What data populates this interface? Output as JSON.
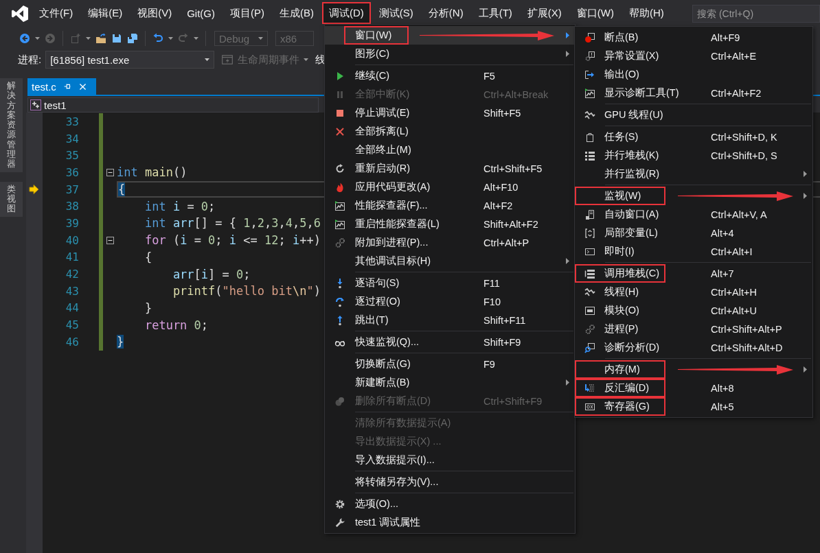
{
  "menubar": {
    "items": [
      {
        "label": "文件(F)",
        "selected": false,
        "highlighted": false
      },
      {
        "label": "编辑(E)",
        "selected": false,
        "highlighted": false
      },
      {
        "label": "视图(V)",
        "selected": false,
        "highlighted": false
      },
      {
        "label": "Git(G)",
        "selected": false,
        "highlighted": false
      },
      {
        "label": "项目(P)",
        "selected": false,
        "highlighted": false
      },
      {
        "label": "生成(B)",
        "selected": false,
        "highlighted": false
      },
      {
        "label": "调试(D)",
        "selected": true,
        "highlighted": true
      },
      {
        "label": "测试(S)",
        "selected": false,
        "highlighted": false
      },
      {
        "label": "分析(N)",
        "selected": false,
        "highlighted": false
      },
      {
        "label": "工具(T)",
        "selected": false,
        "highlighted": false
      },
      {
        "label": "扩展(X)",
        "selected": false,
        "highlighted": false
      },
      {
        "label": "窗口(W)",
        "selected": false,
        "highlighted": false
      },
      {
        "label": "帮助(H)",
        "selected": false,
        "highlighted": false
      }
    ],
    "search": {
      "placeholder": "搜索 (Ctrl+Q)"
    }
  },
  "toolbar": {
    "configuration": "Debug",
    "platform": "x86"
  },
  "debug_location": {
    "label": "进程:",
    "process": "[61856] test1.exe",
    "lifecycle_events": "生命周期事件",
    "thread_label": "线"
  },
  "side_tabs": [
    {
      "label": "解决方案资源管理器"
    },
    {
      "label": "类视图"
    }
  ],
  "editor": {
    "tab": {
      "label": "test.c",
      "selected": true
    },
    "scope": "test1",
    "lines": [
      {
        "number": "33",
        "current": false,
        "foldable": false,
        "modified": true
      },
      {
        "number": "34",
        "current": false,
        "foldable": false,
        "modified": true
      },
      {
        "number": "35",
        "current": false,
        "foldable": false,
        "modified": true
      },
      {
        "number": "36",
        "current": false,
        "foldable": true,
        "modified": true,
        "tokens": [
          {
            "kind": "keyword",
            "text": "int"
          },
          {
            "kind": "function",
            "text": " main"
          },
          {
            "kind": "plain",
            "text": "()"
          }
        ]
      },
      {
        "number": "37",
        "current": true,
        "foldable": false,
        "modified": true,
        "tokens": [
          {
            "kind": "brace-match",
            "text": "{"
          }
        ]
      },
      {
        "number": "38",
        "current": false,
        "foldable": false,
        "modified": true,
        "tokens": [
          {
            "kind": "keyword",
            "text": "    int"
          },
          {
            "kind": "variable",
            "text": " i"
          },
          {
            "kind": "plain",
            "text": " = "
          },
          {
            "kind": "number",
            "text": "0"
          },
          {
            "kind": "plain",
            "text": ";"
          }
        ]
      },
      {
        "number": "39",
        "current": false,
        "foldable": false,
        "modified": true,
        "tokens": [
          {
            "kind": "keyword",
            "text": "    int"
          },
          {
            "kind": "variable",
            "text": " arr"
          },
          {
            "kind": "plain",
            "text": "[] = { "
          },
          {
            "kind": "number",
            "text": "1"
          },
          {
            "kind": "plain",
            "text": ","
          },
          {
            "kind": "number",
            "text": "2"
          },
          {
            "kind": "plain",
            "text": ","
          },
          {
            "kind": "number",
            "text": "3"
          },
          {
            "kind": "plain",
            "text": ","
          },
          {
            "kind": "number",
            "text": "4"
          },
          {
            "kind": "plain",
            "text": ","
          },
          {
            "kind": "number",
            "text": "5"
          },
          {
            "kind": "plain",
            "text": ","
          },
          {
            "kind": "number",
            "text": "6"
          }
        ]
      },
      {
        "number": "40",
        "current": false,
        "foldable": true,
        "modified": true,
        "tokens": [
          {
            "kind": "control",
            "text": "    for"
          },
          {
            "kind": "plain",
            "text": " ("
          },
          {
            "kind": "variable",
            "text": "i"
          },
          {
            "kind": "plain",
            "text": " = "
          },
          {
            "kind": "number",
            "text": "0"
          },
          {
            "kind": "plain",
            "text": "; "
          },
          {
            "kind": "variable",
            "text": "i"
          },
          {
            "kind": "plain",
            "text": " <= "
          },
          {
            "kind": "number",
            "text": "12"
          },
          {
            "kind": "plain",
            "text": "; "
          },
          {
            "kind": "variable",
            "text": "i"
          },
          {
            "kind": "plain",
            "text": "++)"
          }
        ]
      },
      {
        "number": "41",
        "current": false,
        "foldable": false,
        "modified": true,
        "tokens": [
          {
            "kind": "plain",
            "text": "    {"
          }
        ]
      },
      {
        "number": "42",
        "current": false,
        "foldable": false,
        "modified": true,
        "tokens": [
          {
            "kind": "variable",
            "text": "        arr"
          },
          {
            "kind": "plain",
            "text": "["
          },
          {
            "kind": "variable",
            "text": "i"
          },
          {
            "kind": "plain",
            "text": "] = "
          },
          {
            "kind": "number",
            "text": "0"
          },
          {
            "kind": "plain",
            "text": ";"
          }
        ]
      },
      {
        "number": "43",
        "current": false,
        "foldable": false,
        "modified": true,
        "tokens": [
          {
            "kind": "function",
            "text": "        printf"
          },
          {
            "kind": "plain",
            "text": "("
          },
          {
            "kind": "string",
            "text": "\"hello bit"
          },
          {
            "kind": "escape",
            "text": "\\n"
          },
          {
            "kind": "string",
            "text": "\""
          },
          {
            "kind": "plain",
            "text": ")"
          }
        ]
      },
      {
        "number": "44",
        "current": false,
        "foldable": false,
        "modified": true,
        "tokens": [
          {
            "kind": "plain",
            "text": "    }"
          }
        ]
      },
      {
        "number": "45",
        "current": false,
        "foldable": false,
        "modified": true,
        "tokens": [
          {
            "kind": "control",
            "text": "    return"
          },
          {
            "kind": "number",
            "text": " 0"
          },
          {
            "kind": "plain",
            "text": ";"
          }
        ]
      },
      {
        "number": "46",
        "current": false,
        "foldable": false,
        "modified": true,
        "tokens": [
          {
            "kind": "brace-match",
            "text": "}"
          }
        ]
      }
    ]
  },
  "debug_menu": {
    "groups": [
      [
        {
          "label": "窗口(W)",
          "submenu": true,
          "disabled": false,
          "selected": true,
          "highlighted": true,
          "arrow": true
        },
        {
          "label": "图形(C)",
          "submenu": true,
          "disabled": false,
          "selected": false,
          "highlighted": false,
          "arrow": false
        }
      ],
      [
        {
          "label": "继续(C)",
          "shortcut": "F5",
          "submenu": false,
          "disabled": false,
          "selected": false,
          "highlighted": false,
          "arrow": false
        },
        {
          "label": "全部中断(K)",
          "shortcut": "Ctrl+Alt+Break",
          "submenu": false,
          "disabled": true,
          "selected": false,
          "highlighted": false,
          "arrow": false
        },
        {
          "label": "停止调试(E)",
          "shortcut": "Shift+F5",
          "submenu": false,
          "disabled": false,
          "selected": false,
          "highlighted": false,
          "arrow": false
        },
        {
          "label": "全部拆离(L)",
          "submenu": false,
          "disabled": false,
          "selected": false,
          "highlighted": false,
          "arrow": false
        },
        {
          "label": "全部终止(M)",
          "submenu": false,
          "disabled": false,
          "selected": false,
          "highlighted": false,
          "arrow": false
        },
        {
          "label": "重新启动(R)",
          "shortcut": "Ctrl+Shift+F5",
          "submenu": false,
          "disabled": false,
          "selected": false,
          "highlighted": false,
          "arrow": false
        },
        {
          "label": "应用代码更改(A)",
          "shortcut": "Alt+F10",
          "submenu": false,
          "disabled": false,
          "selected": false,
          "highlighted": false,
          "arrow": false
        },
        {
          "label": "性能探查器(F)...",
          "shortcut": "Alt+F2",
          "submenu": false,
          "disabled": false,
          "selected": false,
          "highlighted": false,
          "arrow": false
        },
        {
          "label": "重启性能探查器(L)",
          "shortcut": "Shift+Alt+F2",
          "submenu": false,
          "disabled": false,
          "selected": false,
          "highlighted": false,
          "arrow": false
        },
        {
          "label": "附加到进程(P)...",
          "shortcut": "Ctrl+Alt+P",
          "submenu": false,
          "disabled": false,
          "selected": false,
          "highlighted": false,
          "arrow": false
        },
        {
          "label": "其他调试目标(H)",
          "submenu": true,
          "disabled": false,
          "selected": false,
          "highlighted": false,
          "arrow": false
        }
      ],
      [
        {
          "label": "逐语句(S)",
          "shortcut": "F11",
          "submenu": false,
          "disabled": false,
          "selected": false,
          "highlighted": false,
          "arrow": false
        },
        {
          "label": "逐过程(O)",
          "shortcut": "F10",
          "submenu": false,
          "disabled": false,
          "selected": false,
          "highlighted": false,
          "arrow": false
        },
        {
          "label": "跳出(T)",
          "shortcut": "Shift+F11",
          "submenu": false,
          "disabled": false,
          "selected": false,
          "highlighted": false,
          "arrow": false
        }
      ],
      [
        {
          "label": "快速监视(Q)...",
          "shortcut": "Shift+F9",
          "submenu": false,
          "disabled": false,
          "selected": false,
          "highlighted": false,
          "arrow": false
        }
      ],
      [
        {
          "label": "切换断点(G)",
          "shortcut": "F9",
          "submenu": false,
          "disabled": false,
          "selected": false,
          "highlighted": false,
          "arrow": false
        },
        {
          "label": "新建断点(B)",
          "submenu": true,
          "disabled": false,
          "selected": false,
          "highlighted": false,
          "arrow": false
        },
        {
          "label": "删除所有断点(D)",
          "shortcut": "Ctrl+Shift+F9",
          "submenu": false,
          "disabled": true,
          "selected": false,
          "highlighted": false,
          "arrow": false
        }
      ],
      [
        {
          "label": "清除所有数据提示(A)",
          "submenu": false,
          "disabled": true,
          "selected": false,
          "highlighted": false,
          "arrow": false
        },
        {
          "label": "导出数据提示(X) ...",
          "submenu": false,
          "disabled": true,
          "selected": false,
          "highlighted": false,
          "arrow": false
        },
        {
          "label": "导入数据提示(I)...",
          "submenu": false,
          "disabled": false,
          "selected": false,
          "highlighted": false,
          "arrow": false
        }
      ],
      [
        {
          "label": "将转储另存为(V)...",
          "submenu": false,
          "disabled": false,
          "selected": false,
          "highlighted": false,
          "arrow": false
        }
      ],
      [
        {
          "label": "选项(O)...",
          "submenu": false,
          "disabled": false,
          "selected": false,
          "highlighted": false,
          "arrow": false
        },
        {
          "label": "test1 调试属性",
          "submenu": false,
          "disabled": false,
          "selected": false,
          "highlighted": false,
          "arrow": false
        }
      ]
    ]
  },
  "window_submenu": {
    "groups": [
      [
        {
          "label": "断点(B)",
          "shortcut": "Alt+F9",
          "submenu": false,
          "disabled": false,
          "selected": false,
          "highlighted": false,
          "arrow": false
        },
        {
          "label": "异常设置(X)",
          "shortcut": "Ctrl+Alt+E",
          "submenu": false,
          "disabled": false,
          "selected": false,
          "highlighted": false,
          "arrow": false
        },
        {
          "label": "输出(O)",
          "submenu": false,
          "disabled": false,
          "selected": false,
          "highlighted": false,
          "arrow": false
        },
        {
          "label": "显示诊断工具(T)",
          "shortcut": "Ctrl+Alt+F2",
          "submenu": false,
          "disabled": false,
          "selected": false,
          "highlighted": false,
          "arrow": false
        }
      ],
      [
        {
          "label": "GPU 线程(U)",
          "submenu": false,
          "disabled": false,
          "selected": false,
          "highlighted": false,
          "arrow": false
        }
      ],
      [
        {
          "label": "任务(S)",
          "shortcut": "Ctrl+Shift+D, K",
          "submenu": false,
          "disabled": false,
          "selected": false,
          "highlighted": false,
          "arrow": false
        },
        {
          "label": "并行堆栈(K)",
          "shortcut": "Ctrl+Shift+D, S",
          "submenu": false,
          "disabled": false,
          "selected": false,
          "highlighted": false,
          "arrow": false
        },
        {
          "label": "并行监视(R)",
          "submenu": true,
          "disabled": false,
          "selected": false,
          "highlighted": false,
          "arrow": false
        }
      ],
      [
        {
          "label": "监视(W)",
          "submenu": true,
          "disabled": false,
          "selected": false,
          "highlighted": true,
          "arrow": true
        },
        {
          "label": "自动窗口(A)",
          "shortcut": "Ctrl+Alt+V, A",
          "submenu": false,
          "disabled": false,
          "selected": false,
          "highlighted": false,
          "arrow": false
        },
        {
          "label": "局部变量(L)",
          "shortcut": "Alt+4",
          "submenu": false,
          "disabled": false,
          "selected": false,
          "highlighted": false,
          "arrow": false
        },
        {
          "label": "即时(I)",
          "shortcut": "Ctrl+Alt+I",
          "submenu": false,
          "disabled": false,
          "selected": false,
          "highlighted": false,
          "arrow": false
        }
      ],
      [
        {
          "label": "调用堆栈(C)",
          "shortcut": "Alt+7",
          "submenu": false,
          "disabled": false,
          "selected": false,
          "highlighted": true,
          "arrow": false
        },
        {
          "label": "线程(H)",
          "shortcut": "Ctrl+Alt+H",
          "submenu": false,
          "disabled": false,
          "selected": false,
          "highlighted": false,
          "arrow": false
        },
        {
          "label": "模块(O)",
          "shortcut": "Ctrl+Alt+U",
          "submenu": false,
          "disabled": false,
          "selected": false,
          "highlighted": false,
          "arrow": false
        },
        {
          "label": "进程(P)",
          "shortcut": "Ctrl+Shift+Alt+P",
          "submenu": false,
          "disabled": false,
          "selected": false,
          "highlighted": false,
          "arrow": false
        },
        {
          "label": "诊断分析(D)",
          "shortcut": "Ctrl+Shift+Alt+D",
          "submenu": false,
          "disabled": false,
          "selected": false,
          "highlighted": false,
          "arrow": false
        }
      ],
      [
        {
          "label": "内存(M)",
          "submenu": true,
          "disabled": false,
          "selected": false,
          "highlighted": true,
          "arrow": true
        },
        {
          "label": "反汇编(D)",
          "shortcut": "Alt+8",
          "submenu": false,
          "disabled": false,
          "selected": false,
          "highlighted": true,
          "arrow": false
        },
        {
          "label": "寄存器(G)",
          "shortcut": "Alt+5",
          "submenu": false,
          "disabled": false,
          "selected": false,
          "highlighted": true,
          "arrow": false
        }
      ]
    ]
  }
}
